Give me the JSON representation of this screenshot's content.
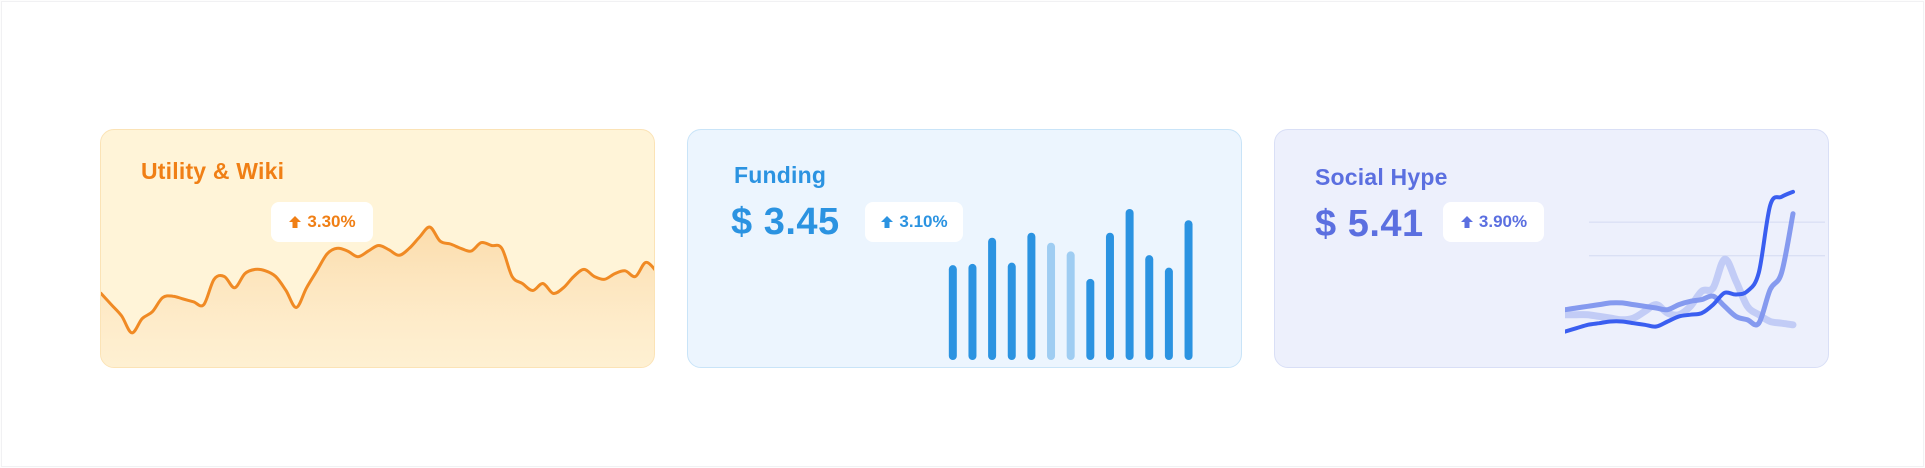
{
  "cards": [
    {
      "title": "Utility & Wiki",
      "change": "3.30%",
      "accent": "#f07f15",
      "chart_data": {
        "type": "area",
        "x": [
          0,
          1,
          2,
          3,
          4,
          5,
          6,
          7,
          8,
          9,
          10,
          11,
          12,
          13,
          14,
          15,
          16,
          17,
          18,
          19,
          20,
          21,
          22,
          23,
          24,
          25,
          26,
          27,
          28,
          29,
          30,
          31,
          32,
          33,
          34,
          35,
          36,
          37,
          38,
          39,
          40,
          41,
          42,
          43,
          44,
          45,
          46,
          47,
          48,
          49,
          50,
          51,
          52,
          53,
          54
        ],
        "values": [
          48,
          40,
          32,
          20,
          30,
          35,
          45,
          46,
          44,
          42,
          40,
          58,
          60,
          52,
          62,
          65,
          64,
          60,
          50,
          38,
          52,
          64,
          76,
          80,
          78,
          74,
          78,
          82,
          79,
          75,
          80,
          88,
          95,
          85,
          83,
          80,
          78,
          84,
          82,
          80,
          60,
          55,
          50,
          55,
          48,
          52,
          60,
          65,
          60,
          58,
          62,
          64,
          60,
          70,
          64
        ],
        "ylim": [
          0,
          110
        ]
      }
    },
    {
      "title": "Funding",
      "value": "$ 3.45",
      "change": "3.10%",
      "accent": "#2b93e1",
      "chart_data": {
        "type": "bar",
        "categories": [
          "1",
          "2",
          "3",
          "4",
          "5",
          "6",
          "7",
          "8",
          "9",
          "10",
          "11",
          "12",
          "13",
          "14"
        ],
        "values": [
          76,
          77,
          98,
          78,
          102,
          94,
          87,
          65,
          102,
          121,
          84,
          74,
          112,
          0
        ],
        "highlight": [
          false,
          false,
          false,
          false,
          false,
          true,
          true,
          false,
          false,
          false,
          false,
          false,
          false,
          false
        ],
        "ylim": [
          0,
          125
        ]
      }
    },
    {
      "title": "Social Hype",
      "value": "$ 5.41",
      "change": "3.90%",
      "accent": "#5b6fe0",
      "chart_data": {
        "type": "line",
        "series": [
          {
            "values": [
              30,
              30,
              30,
              28,
              26,
              24,
              26,
              34,
              42,
              32,
              30,
              40,
              58,
              62,
              96,
              70,
              40,
              30,
              22,
              20,
              18
            ]
          },
          {
            "values": [
              36,
              38,
              40,
              42,
              44,
              44,
              42,
              40,
              38,
              36,
              42,
              46,
              48,
              52,
              40,
              28,
              24,
              20,
              60,
              80,
              150
            ]
          },
          {
            "values": [
              10,
              14,
              18,
              20,
              22,
              22,
              20,
              18,
              16,
              22,
              28,
              30,
              32,
              42,
              56,
              54,
              58,
              80,
              160,
              170,
              176
            ]
          }
        ],
        "gridlines": [
          100,
          140
        ],
        "ylim": [
          0,
          190
        ]
      }
    }
  ]
}
